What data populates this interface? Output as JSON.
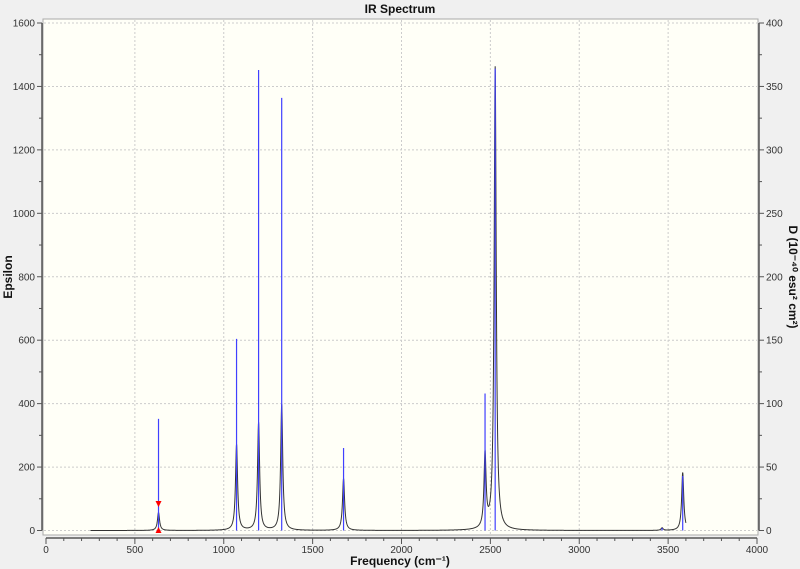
{
  "chart_data": {
    "type": "line",
    "title": "IR Spectrum",
    "xlabel": "Frequency (cm⁻¹)",
    "ylabel": "Epsilon",
    "y2label": "D (10⁻⁴⁰ esu² cm²)",
    "xlim": [
      0,
      4000
    ],
    "ylim": [
      0,
      1600
    ],
    "y2lim": [
      0,
      400
    ],
    "xticks": [
      0,
      500,
      1000,
      1500,
      2000,
      2500,
      3000,
      3500,
      4000
    ],
    "yticks": [
      0,
      200,
      400,
      600,
      800,
      1000,
      1200,
      1400,
      1600
    ],
    "y2ticks": [
      0,
      50,
      100,
      150,
      200,
      250,
      300,
      350,
      400
    ],
    "grid": true,
    "spectrum_range": [
      250,
      3600
    ],
    "series": [
      {
        "name": "Epsilon spectrum",
        "axis": "left",
        "color": "#000000",
        "peaks_x": [
          633,
          1072,
          1196,
          1326,
          1674,
          2470,
          2527,
          3466,
          3582
        ],
        "peaks_y": [
          57,
          271,
          340,
          397,
          164,
          233,
          1460,
          8,
          183
        ]
      },
      {
        "name": "Dipole strength sticks",
        "axis": "right",
        "color": "#4040ff",
        "x": [
          633,
          1072,
          1196,
          1326,
          1674,
          2470,
          2527,
          3466,
          3582
        ],
        "y": [
          88,
          151,
          363,
          341,
          65,
          108,
          364,
          2,
          43
        ]
      }
    ],
    "marker": {
      "x": 633,
      "color": "#ff0000"
    }
  }
}
